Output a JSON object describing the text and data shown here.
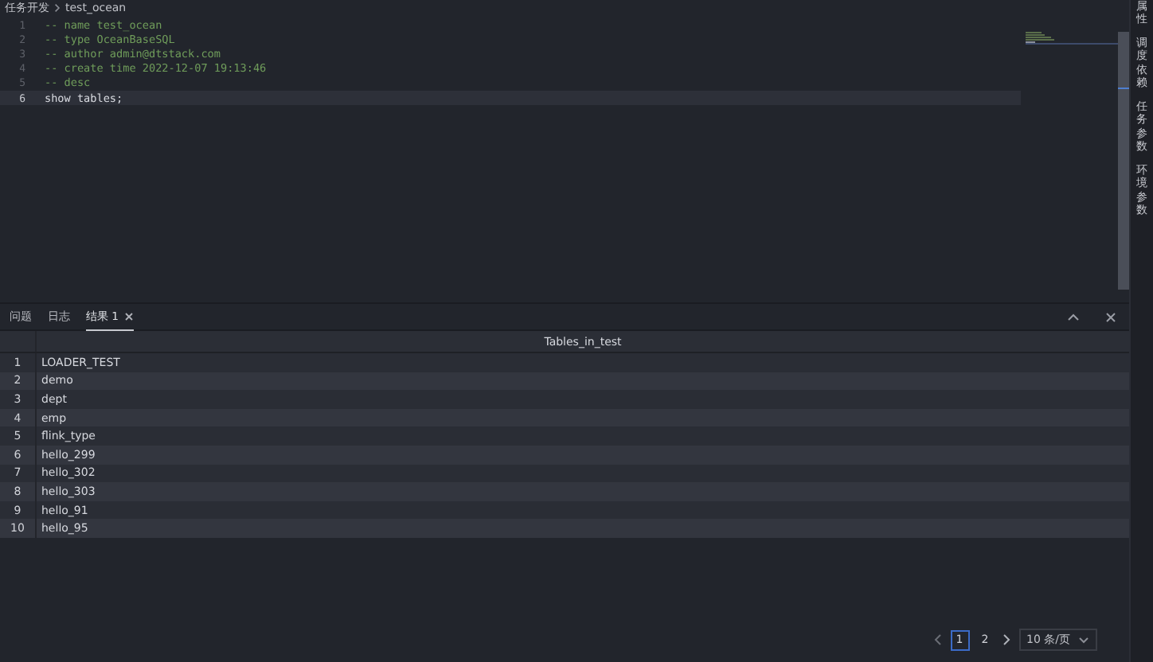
{
  "breadcrumb": [
    "任务开发",
    "test_ocean"
  ],
  "editor": {
    "lines": [
      {
        "number": "1",
        "kind": "comment",
        "text": "-- name test_ocean",
        "selected": false
      },
      {
        "number": "2",
        "kind": "comment",
        "text": "-- type OceanBaseSQL",
        "selected": false
      },
      {
        "number": "3",
        "kind": "comment",
        "text": "-- author admin@dtstack.com",
        "selected": false
      },
      {
        "number": "4",
        "kind": "comment",
        "text": "-- create time 2022-12-07 19:13:46",
        "selected": false
      },
      {
        "number": "5",
        "kind": "comment",
        "text": "-- desc",
        "selected": false
      },
      {
        "number": "6",
        "kind": "code",
        "text": "show tables;",
        "selected": true
      }
    ]
  },
  "side_tabs": [
    {
      "label": "属性"
    },
    {
      "label": "调度依赖"
    },
    {
      "label": "任务参数"
    },
    {
      "label": "环境参数"
    }
  ],
  "panel": {
    "tabs": [
      {
        "label": "问题",
        "selected": false,
        "closable": false
      },
      {
        "label": "日志",
        "selected": false,
        "closable": false
      },
      {
        "label": "结果 1",
        "selected": true,
        "closable": true
      }
    ]
  },
  "table": {
    "columns": [
      "Tables_in_test"
    ],
    "rows": [
      {
        "index": "1",
        "value": "LOADER_TEST"
      },
      {
        "index": "2",
        "value": "demo"
      },
      {
        "index": "3",
        "value": "dept"
      },
      {
        "index": "4",
        "value": "emp"
      },
      {
        "index": "5",
        "value": "flink_type"
      },
      {
        "index": "6",
        "value": "hello_299"
      },
      {
        "index": "7",
        "value": "hello_302"
      },
      {
        "index": "8",
        "value": "hello_303"
      },
      {
        "index": "9",
        "value": "hello_91"
      },
      {
        "index": "10",
        "value": "hello_95"
      }
    ]
  },
  "pagination": {
    "pages": [
      {
        "label": "1",
        "selected": true
      },
      {
        "label": "2",
        "selected": false
      }
    ],
    "page_size": "10 条/页"
  }
}
